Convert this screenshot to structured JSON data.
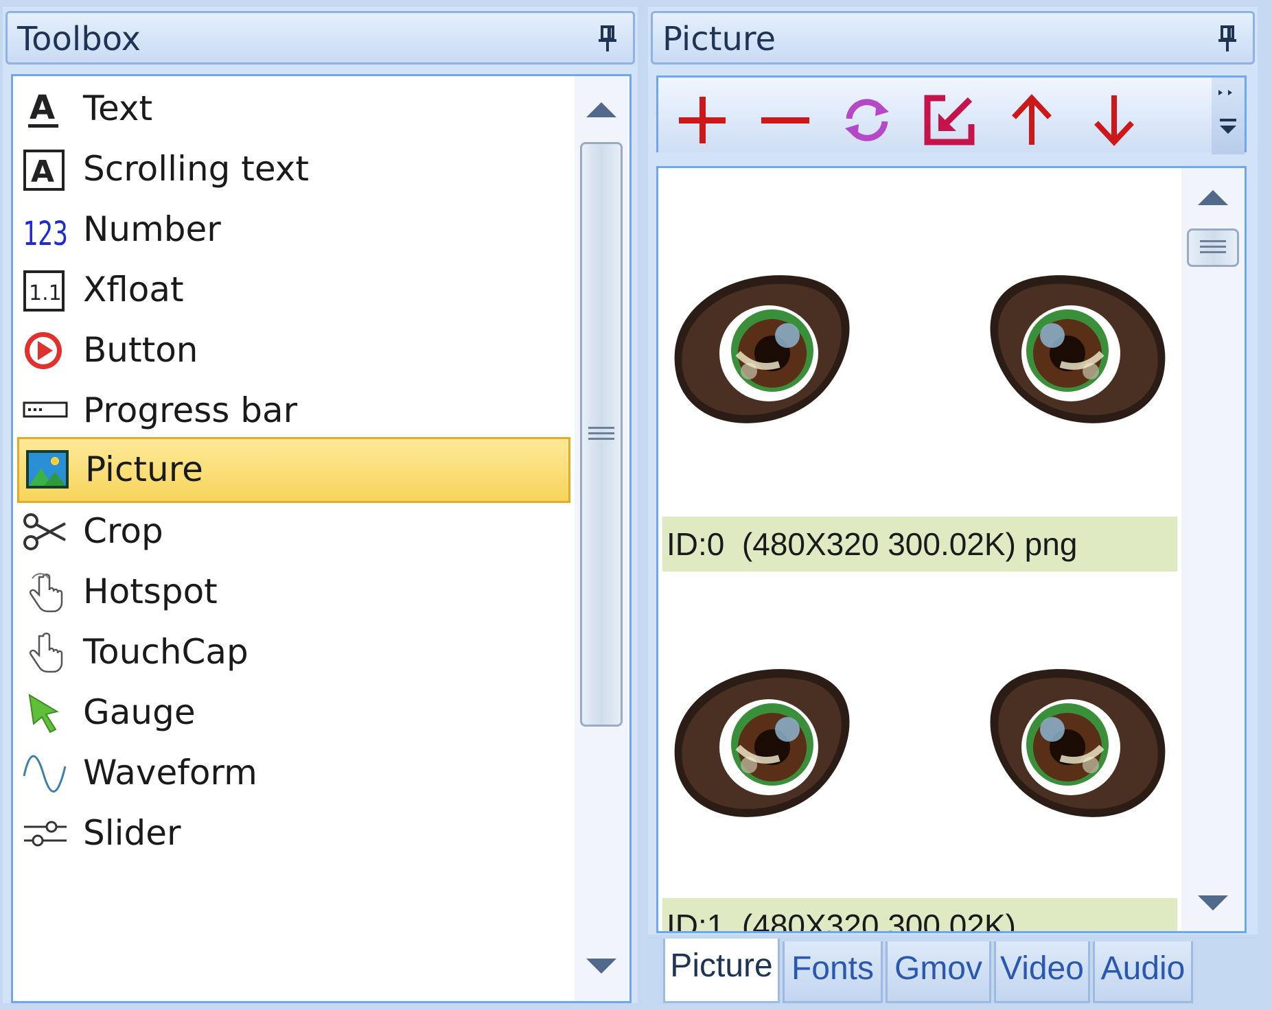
{
  "toolbox": {
    "title": "Toolbox",
    "items": [
      {
        "label": "Text",
        "icon": "text-a-icon"
      },
      {
        "label": "Scrolling text",
        "icon": "scrolling-text-icon"
      },
      {
        "label": "Number",
        "icon": "number-icon"
      },
      {
        "label": "Xfloat",
        "icon": "xfloat-icon"
      },
      {
        "label": "Button",
        "icon": "button-play-icon"
      },
      {
        "label": "Progress bar",
        "icon": "progress-bar-icon"
      },
      {
        "label": "Picture",
        "icon": "picture-icon",
        "selected": true
      },
      {
        "label": "Crop",
        "icon": "scissors-icon"
      },
      {
        "label": "Hotspot",
        "icon": "hand-pointer-icon"
      },
      {
        "label": "TouchCap",
        "icon": "touch-hand-icon"
      },
      {
        "label": "Gauge",
        "icon": "gauge-pointer-icon"
      },
      {
        "label": "Waveform",
        "icon": "waveform-icon"
      },
      {
        "label": "Slider",
        "icon": "slider-icon"
      }
    ]
  },
  "picture_panel": {
    "title": "Picture",
    "toolbar": [
      {
        "name": "add",
        "icon": "plus-icon",
        "color": "#cc1818"
      },
      {
        "name": "remove",
        "icon": "minus-icon",
        "color": "#cc1818"
      },
      {
        "name": "replace",
        "icon": "refresh-icon",
        "color": "#b548c6"
      },
      {
        "name": "export",
        "icon": "export-icon",
        "color": "#c4144a"
      },
      {
        "name": "move-up",
        "icon": "arrow-up-icon",
        "color": "#cc1818"
      },
      {
        "name": "move-down",
        "icon": "arrow-down-icon",
        "color": "#cc1818"
      }
    ],
    "images": [
      {
        "caption": "ID:0  (480X320 300.02K) png"
      },
      {
        "caption": "ID:1  (480X320 300.02K)"
      }
    ],
    "tabs": [
      {
        "label": "Picture",
        "active": true
      },
      {
        "label": "Fonts"
      },
      {
        "label": "Gmov"
      },
      {
        "label": "Video"
      },
      {
        "label": "Audio"
      }
    ]
  }
}
